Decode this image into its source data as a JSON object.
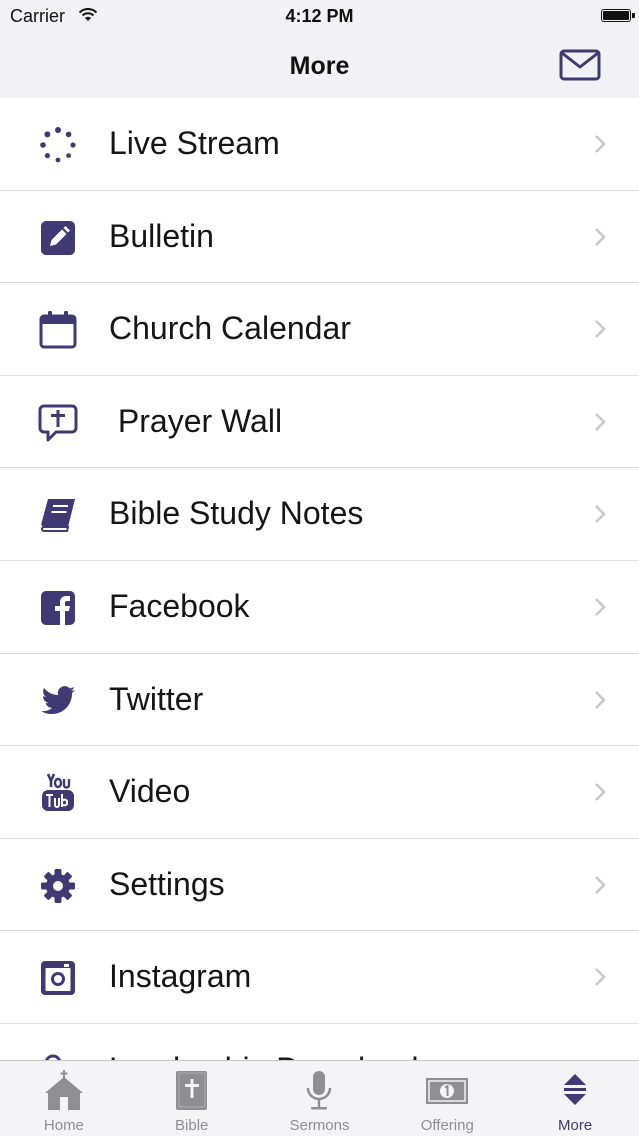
{
  "status": {
    "carrier": "Carrier",
    "time": "4:12 PM"
  },
  "nav": {
    "title": "More",
    "mail_icon": "mail-icon"
  },
  "colors": {
    "accent": "#3f3a73",
    "inactive": "#8e8e93",
    "chevron": "#c7c7cc"
  },
  "list": {
    "items": [
      {
        "label": "Live Stream",
        "icon": "live-stream-icon"
      },
      {
        "label": "Bulletin",
        "icon": "pencil-square-icon"
      },
      {
        "label": "Church Calendar",
        "icon": "calendar-icon"
      },
      {
        "label": " Prayer Wall",
        "icon": "prayer-bubble-icon"
      },
      {
        "label": "Bible Study Notes",
        "icon": "book-icon"
      },
      {
        "label": "Facebook",
        "icon": "facebook-icon"
      },
      {
        "label": "Twitter",
        "icon": "twitter-icon"
      },
      {
        "label": "Video",
        "icon": "youtube-icon"
      },
      {
        "label": "Settings",
        "icon": "gear-icon"
      },
      {
        "label": "Instagram",
        "icon": "instagram-icon"
      },
      {
        "label": "Leadership Downloads",
        "icon": "download-icon"
      }
    ]
  },
  "tabs": [
    {
      "label": "Home",
      "icon": "church-icon"
    },
    {
      "label": "Bible",
      "icon": "bible-icon"
    },
    {
      "label": "Sermons",
      "icon": "microphone-icon"
    },
    {
      "label": "Offering",
      "icon": "money-icon"
    },
    {
      "label": "More",
      "icon": "more-icon",
      "active": true
    }
  ]
}
